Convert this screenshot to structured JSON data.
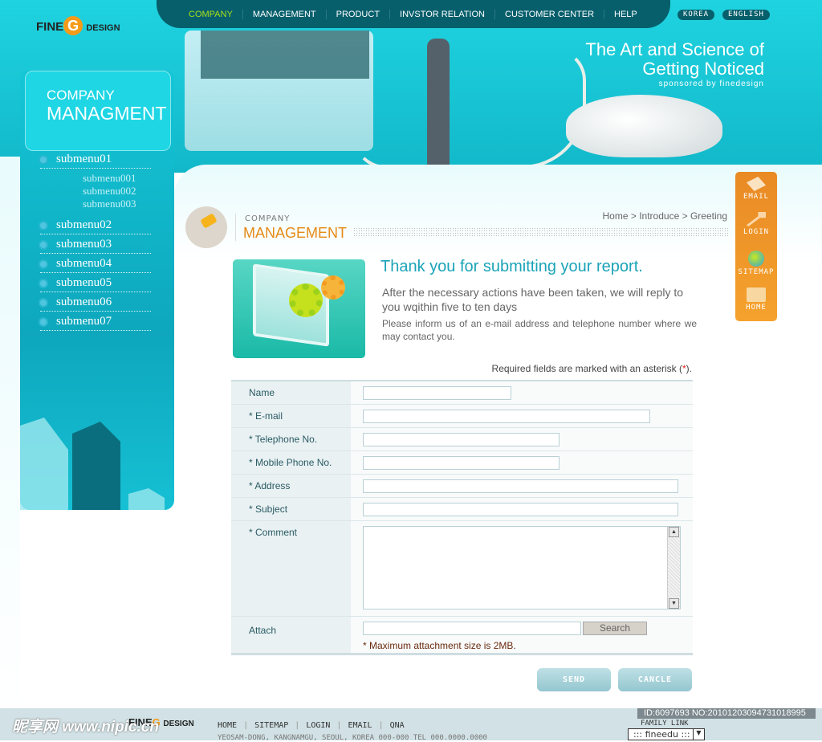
{
  "brand": {
    "logo_left": "FINE",
    "logo_g": "G",
    "logo_right": "DESIGN"
  },
  "nav": [
    {
      "label": "COMPANY",
      "active": true
    },
    {
      "label": "MANAGEMENT"
    },
    {
      "label": "PRODUCT"
    },
    {
      "label": "INVSTOR RELATION"
    },
    {
      "label": "CUSTOMER CENTER"
    },
    {
      "label": "HELP"
    }
  ],
  "lang": {
    "korea": "KOREA",
    "english": "ENGLISH"
  },
  "slogan": {
    "line1": "The Art and Science of",
    "line2": "Getting Noticed",
    "sponsor": "sponsored by finedesign"
  },
  "sidebar": {
    "title1": "COMPANY",
    "title2": "MANAGMENT",
    "items": [
      "submenu01",
      "submenu02",
      "submenu03",
      "submenu04",
      "submenu05",
      "submenu06",
      "submenu07"
    ],
    "subitems": [
      "submenu001",
      "submenu002",
      "submenu003"
    ]
  },
  "quick": {
    "email": "EMAIL",
    "login": "LOGIN",
    "sitemap": "SITEMAP",
    "home": "HOME"
  },
  "page": {
    "category": "COMPANY",
    "title": "MANAGEMENT",
    "breadcrumb": [
      "Home",
      "Introduce",
      "Greeting"
    ],
    "breadcrumb_sep": ">"
  },
  "message": {
    "title": "Thank you for submitting your report.",
    "reply": "After the necessary actions have been taken,  we will reply to you wqithin five to ten days",
    "inform": "Please  inform  us of an  e-mail address and telephone  number where we may contact you."
  },
  "form": {
    "required_note": "Required fields are marked with an asterisk (",
    "required_star": "*",
    "required_end": ").",
    "name": "Name",
    "email": "* E-mail",
    "telephone": "* Telephone No.",
    "mobile": "* Mobile Phone No.",
    "address": "* Address",
    "subject": "* Subject",
    "comment": "* Comment",
    "attach": "Attach",
    "search": "Search",
    "max_size": "* Maximum attachment size is 2MB.",
    "send": "SEND",
    "cancel": "CANCLE"
  },
  "footer": {
    "links": [
      "HOME",
      "SITEMAP",
      "LOGIN",
      "EMAIL",
      "QNA"
    ],
    "address": "YEOSAM-DONG, KANGNAMGU, SEOUL, KOREA 000-000    TEL 000.0000.0000",
    "family_link": "FAMILY LINK",
    "family_select": "::: fineedu :::"
  },
  "watermark": {
    "site": "昵享网 www.nipic.cn",
    "id": "ID:6097693 NO:20101203094731018995"
  },
  "colors": {
    "accent": "#1ba3b8",
    "orange": "#e58a14",
    "nav_bg": "#075f6c",
    "active_nav": "#a8e01a"
  }
}
